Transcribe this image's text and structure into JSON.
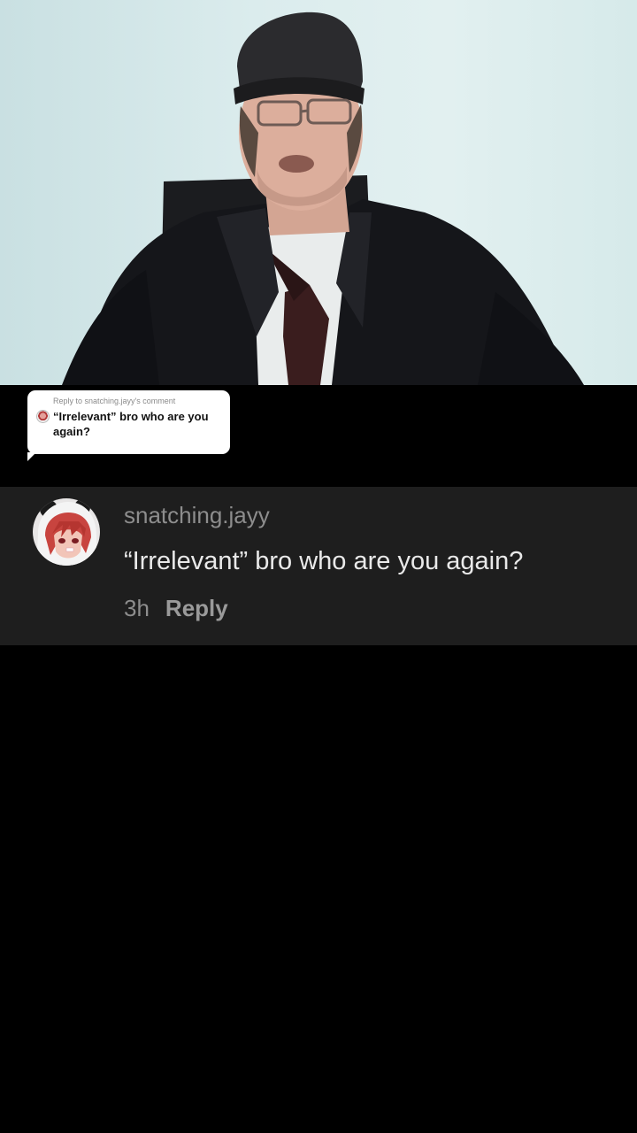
{
  "reply_sticker": {
    "reply_to_label": "Reply to snatching.jayy's comment",
    "quoted_comment": "“Irrelevant” bro who are you again?",
    "avatar_icon": "anime-avatar-icon"
  },
  "comment": {
    "username": "snatching.jayy",
    "text": "“Irrelevant” bro who are you again?",
    "timestamp": "3h",
    "reply_label": "Reply",
    "avatar_icon": "anime-avatar-icon"
  },
  "colors": {
    "background": "#000000",
    "card_background": "#1e1e1e",
    "username": "#8d8d8d",
    "comment_text": "#e9e9e9",
    "sticker_background": "#ffffff"
  }
}
